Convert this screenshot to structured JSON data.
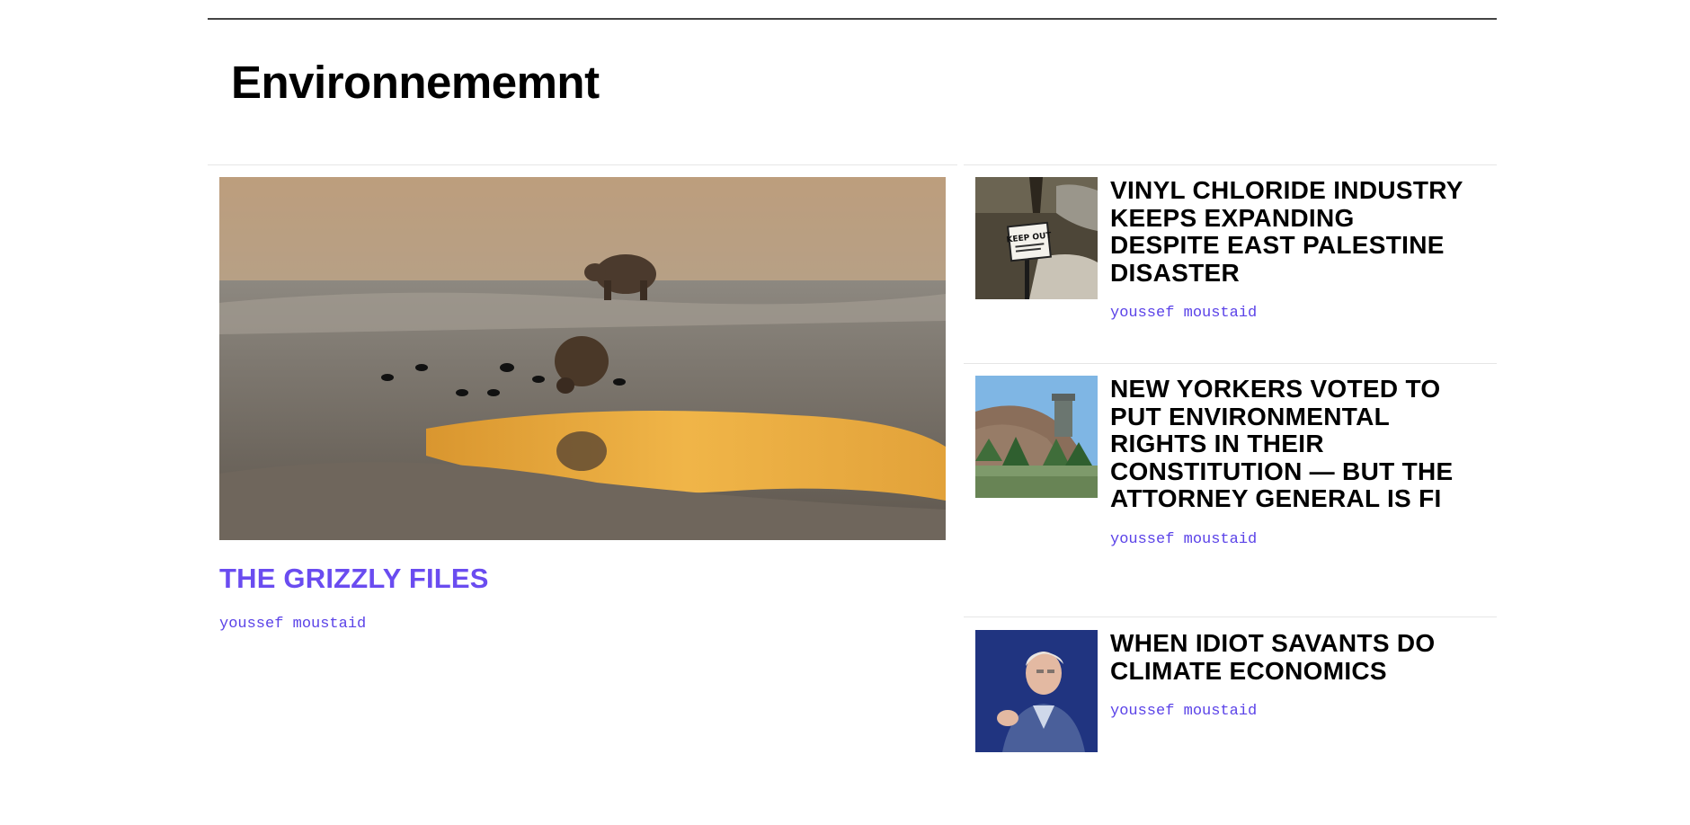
{
  "section": {
    "title": "Environnememnt"
  },
  "featured": {
    "title": "THE GRIZZLY FILES",
    "author": "youssef moustaid",
    "image_icon": "grizzly-bears-landscape-photo"
  },
  "side_articles": [
    {
      "title": "VINYL CHLORIDE INDUSTRY KEEPS EXPANDING DESPITE EAST PALESTINE DISASTER",
      "author": "youssef moustaid",
      "sign_text": "KEEP OUT",
      "image_icon": "keep-out-sign-photo"
    },
    {
      "title": "NEW YORKERS VOTED TO PUT ENVIRONMENTAL RIGHTS IN THEIR CONSTITUTION — BUT THE ATTORNEY GENERAL IS FI",
      "author": "youssef moustaid",
      "image_icon": "gravel-mound-photo"
    },
    {
      "title": "WHEN IDIOT SAVANTS DO CLIMATE ECONOMICS",
      "author": "youssef moustaid",
      "image_icon": "speaker-portrait-photo"
    }
  ],
  "colors": {
    "accent": "#6a4cf0",
    "author_link": "#5b43e8",
    "text": "#000000",
    "divider": "#e6e6e6"
  }
}
